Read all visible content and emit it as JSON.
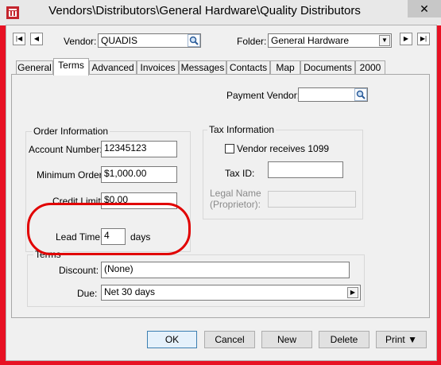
{
  "window": {
    "title": "Vendors\\Distributors\\General Hardware\\Quality Distributors",
    "close_glyph": "✕"
  },
  "header": {
    "vendor_label": "Vendor:",
    "vendor_value": "QUADIS",
    "folder_label": "Folder:",
    "folder_value": "General Hardware"
  },
  "tabs": [
    "General",
    "Terms",
    "Advanced",
    "Invoices",
    "Messages",
    "Contacts",
    "Map",
    "Documents",
    "2000"
  ],
  "active_tab": "Terms",
  "payment_vendor": {
    "label": "Payment Vendor:",
    "value": ""
  },
  "order_info": {
    "title": "Order Information",
    "account_number_label": "Account Number:",
    "account_number_value": "12345123",
    "minimum_order_label": "Minimum Order:",
    "minimum_order_value": "$1,000.00",
    "credit_limit_label": "Credit Limit:",
    "credit_limit_value": "$0.00",
    "lead_time_label": "Lead Time:",
    "lead_time_value": "4",
    "lead_time_unit": "days"
  },
  "tax_info": {
    "title": "Tax Information",
    "checkbox_label": "Vendor receives 1099",
    "checkbox_checked": false,
    "tax_id_label": "Tax ID:",
    "tax_id_value": "",
    "legal_name_label_1": "Legal Name",
    "legal_name_label_2": "(Proprietor):",
    "legal_name_value": ""
  },
  "terms": {
    "title": "Terms",
    "discount_label": "Discount:",
    "discount_value": "(None)",
    "due_label": "Due:",
    "due_value": "Net  30 days"
  },
  "buttons": {
    "ok": "OK",
    "cancel": "Cancel",
    "new": "New",
    "delete": "Delete",
    "print": "Print"
  },
  "colors": {
    "annotation": "#e10000",
    "window_border": "#e81123"
  }
}
